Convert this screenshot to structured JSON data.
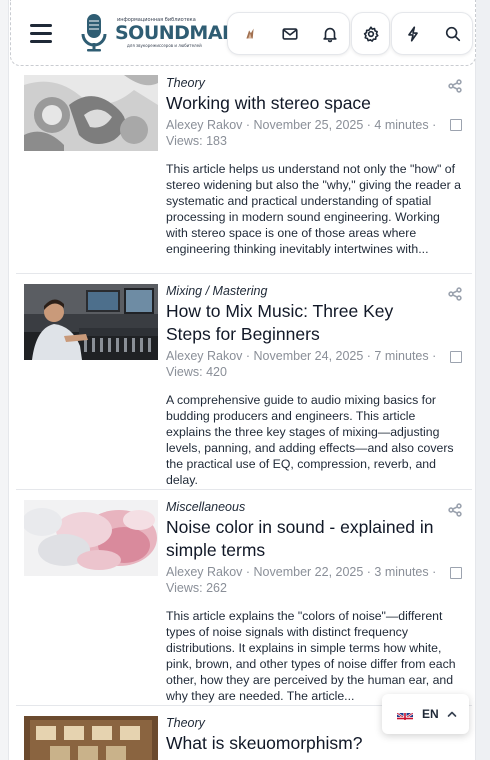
{
  "header": {
    "logo": {
      "wordmark": "SOUNDMAIN",
      "tagline_top": "информационная библиотека",
      "tagline_bottom": "для звукорежиссеров и любителей"
    },
    "icons": [
      "menu-icon",
      "avatar-icon",
      "mail-icon",
      "bell-icon",
      "gear-icon",
      "lightning-icon",
      "search-icon"
    ]
  },
  "articles": [
    {
      "category": "Theory",
      "title": "Working with stereo space",
      "meta": "Alexey Rakov · November 25, 2025 · 4 minutes · Views: 183",
      "excerpt": "This article helps us understand not only the \"how\" of stereo widening but also the \"why,\" giving the reader a systematic and practical understanding of spatial processing in modern sound engineering. Working with stereo space is one of those areas where engineering thinking inevitably intertwines with..."
    },
    {
      "category": "Mixing / Mastering",
      "title": "How to Mix Music: Three Key Steps for Beginners",
      "meta": "Alexey Rakov · November 24, 2025 · 7 minutes · Views: 420",
      "excerpt": "A comprehensive guide to audio mixing basics for budding producers and engineers. This article explains the three key stages of mixing—adjusting levels, panning, and adding effects—and also covers the practical use of EQ, compression, reverb, and delay."
    },
    {
      "category": "Miscellaneous",
      "title": "Noise color in sound - explained in simple terms",
      "meta": "Alexey Rakov · November 22, 2025 · 3 minutes · Views: 262",
      "excerpt": "This article explains the \"colors of noise\"—different types of noise signals with distinct frequency distributions. It explains in simple terms how white, pink, brown, and other types of noise differ from each other, how they are perceived by the human ear, and why they are needed. The article..."
    },
    {
      "category": "Theory",
      "title": "What is skeuomorphism?",
      "meta": "",
      "excerpt": ""
    }
  ],
  "language": {
    "code": "EN"
  },
  "colors": {
    "logo": "#2f5d73",
    "meta": "#8a8f98",
    "divider": "#e5e7eb"
  }
}
